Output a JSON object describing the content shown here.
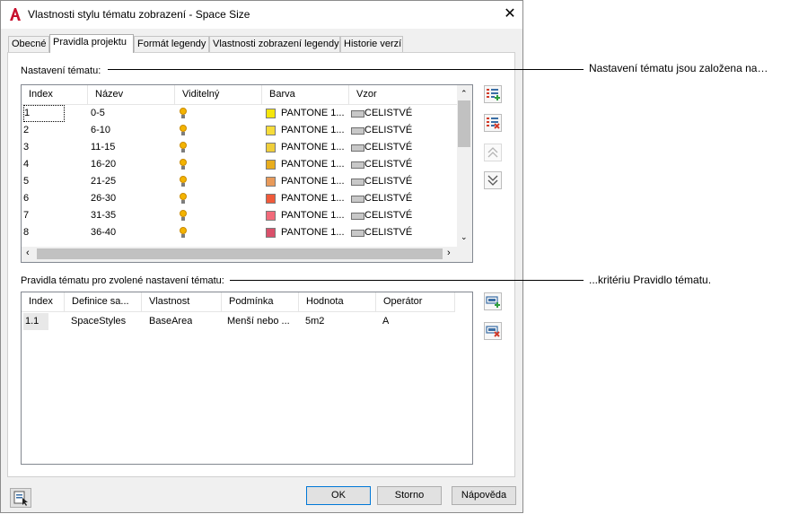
{
  "window": {
    "title": "Vlastnosti stylu tématu zobrazení - Space Size"
  },
  "tabs": [
    {
      "label": "Obecné"
    },
    {
      "label": "Pravidla projektu"
    },
    {
      "label": "Formát legendy"
    },
    {
      "label": "Vlastnosti zobrazení legendy"
    },
    {
      "label": "Historie verzí"
    }
  ],
  "theme_settings": {
    "label": "Nastavení tématu:",
    "columns": [
      "Index",
      "Název",
      "Viditelný",
      "Barva",
      "Vzor"
    ],
    "rows": [
      {
        "index": "1",
        "name": "0-5",
        "color_label": "PANTONE 1...",
        "color": "#f5e60c",
        "pattern": "CELISTVÉ"
      },
      {
        "index": "2",
        "name": "6-10",
        "color_label": "PANTONE 1...",
        "color": "#f6dc3a",
        "pattern": "CELISTVÉ"
      },
      {
        "index": "3",
        "name": "11-15",
        "color_label": "PANTONE 1...",
        "color": "#efce3a",
        "pattern": "CELISTVÉ"
      },
      {
        "index": "4",
        "name": "16-20",
        "color_label": "PANTONE 1...",
        "color": "#e8ad1e",
        "pattern": "CELISTVÉ"
      },
      {
        "index": "5",
        "name": "21-25",
        "color_label": "PANTONE 1...",
        "color": "#e89a5a",
        "pattern": "CELISTVÉ"
      },
      {
        "index": "6",
        "name": "26-30",
        "color_label": "PANTONE 1...",
        "color": "#f05a3a",
        "pattern": "CELISTVÉ"
      },
      {
        "index": "7",
        "name": "31-35",
        "color_label": "PANTONE 1...",
        "color": "#f26a7a",
        "pattern": "CELISTVÉ"
      },
      {
        "index": "8",
        "name": "36-40",
        "color_label": "PANTONE 1...",
        "color": "#d9506a",
        "pattern": "CELISTVÉ"
      }
    ]
  },
  "theme_rules": {
    "label": "Pravidla tématu pro zvolené nastavení tématu:",
    "columns": [
      "Index",
      "Definice sa...",
      "Vlastnost",
      "Podmínka",
      "Hodnota",
      "Operátor"
    ],
    "rows": [
      {
        "index": "1.1",
        "definition": "SpaceStyles",
        "property": "BaseArea",
        "condition": "Menší nebo ...",
        "value": "5m2",
        "operator": "A"
      }
    ]
  },
  "buttons": {
    "ok": "OK",
    "cancel": "Storno",
    "help": "Nápověda"
  },
  "callouts": {
    "settings": "Nastavení tématu jsou založena na…",
    "rules": "...kritériu Pravidlo tématu."
  },
  "icons": {
    "app": "autocad-logo-icon",
    "add_setting": "add-theme-setting-icon",
    "delete_setting": "delete-theme-setting-icon",
    "move_up": "move-up-icon",
    "move_down": "move-down-icon",
    "add_rule": "add-rule-icon",
    "delete_rule": "delete-rule-icon",
    "details": "details-toggle-icon"
  },
  "colors": {
    "accent": "#0078d7",
    "bulb": "#f4b400",
    "app_red": "#c8102e"
  }
}
